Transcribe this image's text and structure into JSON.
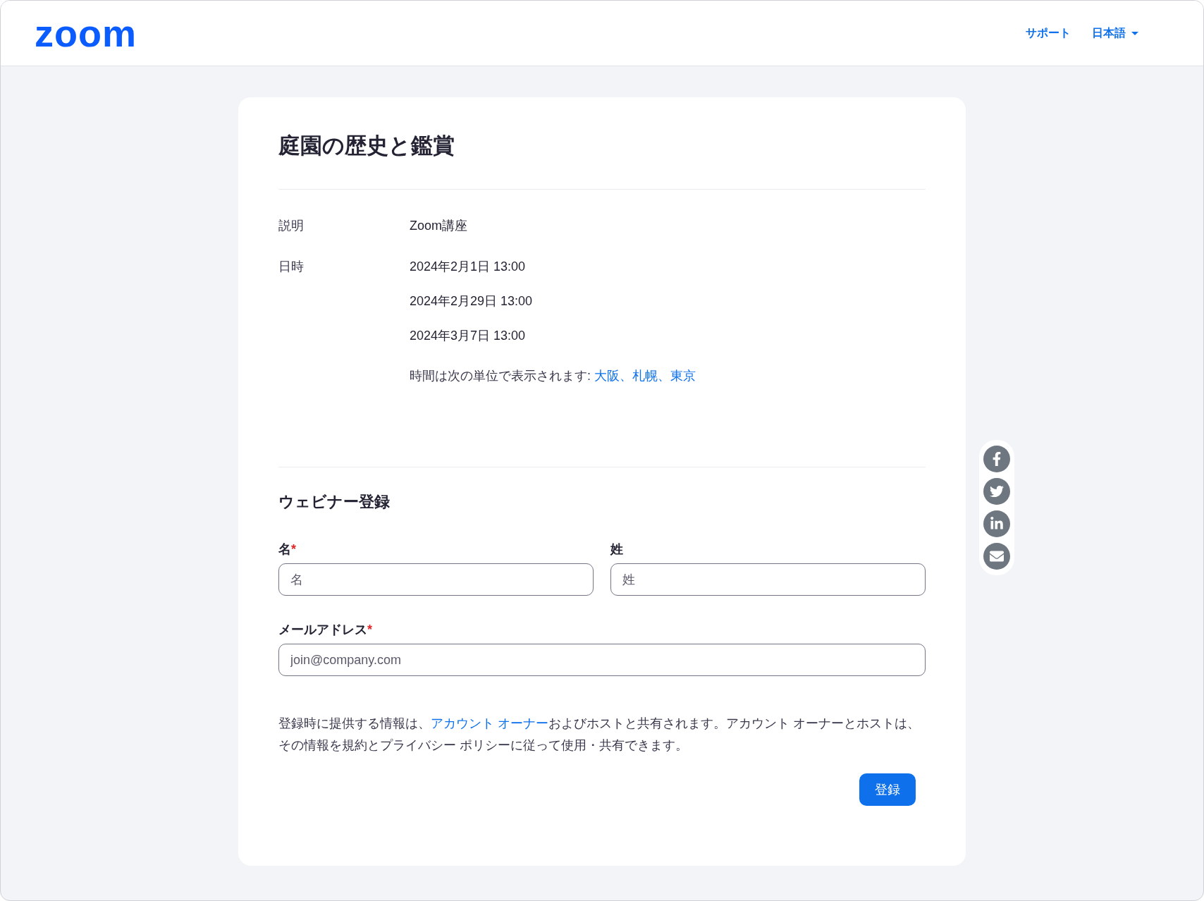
{
  "header": {
    "logo": "zoom",
    "links": [
      {
        "label": "サポート",
        "kind": "link"
      },
      {
        "label": "日本語",
        "kind": "dropdown"
      }
    ]
  },
  "event": {
    "title": "庭園の歴史と鑑賞",
    "description": {
      "label": "説明",
      "value": "Zoom講座"
    },
    "schedule": {
      "label": "日時",
      "dates": [
        "2024年2月1日 13:00",
        "2024年2月29日 13:00",
        "2024年3月7日 13:00"
      ],
      "timezone_text": "時間は次の単位で表示されます: ",
      "timezone_link": "大阪、札幌、東京"
    }
  },
  "registration": {
    "title": "ウェビナー登録",
    "fields": [
      {
        "label": "名",
        "required_mark": "*",
        "placeholder": "名",
        "kind": "half"
      },
      {
        "label": "姓",
        "placeholder": "姓",
        "kind": "half"
      },
      {
        "label": "メールアドレス",
        "required_mark": "*",
        "placeholder": "join@company.com",
        "kind": "full"
      }
    ],
    "disclaimer": {
      "before": "登録時に提供する情報は、",
      "link": "アカウント オーナー",
      "after": "およびホストと共有されます。アカウント オーナーとホストは、その情報を規約とプライバシー ポリシーに従って使用・共有できます。"
    },
    "submit": "登録"
  },
  "share": [
    {
      "kind": "facebook"
    },
    {
      "kind": "twitter"
    },
    {
      "kind": "linkedin"
    },
    {
      "kind": "email"
    }
  ]
}
